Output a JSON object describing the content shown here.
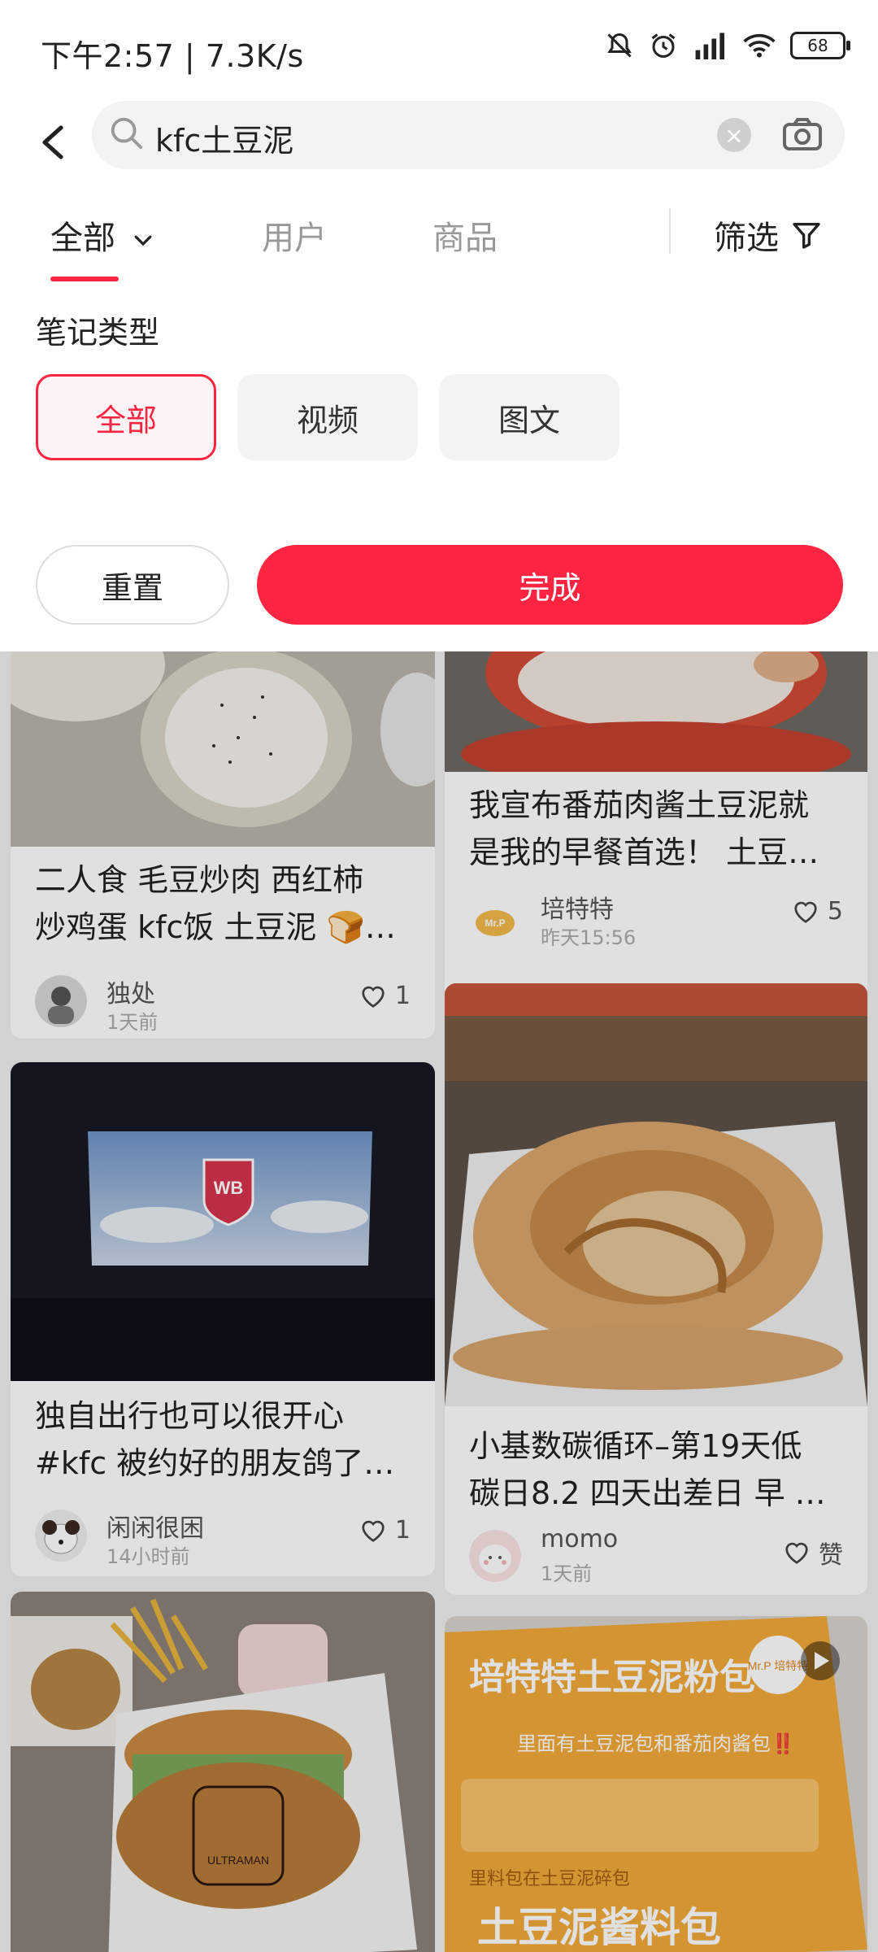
{
  "status": {
    "time": "下午2:57 | 7.3K/s",
    "battery": "68"
  },
  "search": {
    "query": "kfc土豆泥"
  },
  "tabs": {
    "all": "全部",
    "users": "用户",
    "products": "商品",
    "filter": "筛选"
  },
  "panel": {
    "title": "笔记类型",
    "chips": [
      "全部",
      "视频",
      "图文"
    ],
    "reset": "重置",
    "done": "完成"
  },
  "colors": {
    "accent": "#ff2442"
  },
  "feed": {
    "left": [
      {
        "title1": "二人食 毛豆炒肉 西红柿",
        "title2": "炒鸡蛋 kfc饭 土豆泥 🍞…",
        "author": "独处",
        "time": "1天前",
        "likes": "1"
      },
      {
        "title1": "独自出行也可以很开心",
        "title2": "#kfc  被约好的朋友鸽了…",
        "author": "闲闲很困",
        "time": "14小时前",
        "likes": "1"
      }
    ],
    "right": [
      {
        "title1": "我宣布番茄肉酱土豆泥就",
        "title2": "是我的早餐首选！ 土豆…",
        "author": "培特特",
        "time": "昨天15:56",
        "likes": "5"
      },
      {
        "title1": "小基数碳循环–第19天低",
        "title2": "碳日8.2 四天出差日 早 …",
        "author": "momo",
        "time": "1天前",
        "likes": "赞"
      }
    ],
    "img_text": {
      "wb": "WB",
      "pack_brand": "培特特土豆泥粉包",
      "pack_caption": "里面有土豆泥包和番茄肉酱包‼️",
      "pack_sub": "里料包在土豆泥碎包",
      "pack_logo": "Mr.P 培特特",
      "avatar_logo": "Mr.P",
      "burger_print": "ULTRAMAN"
    }
  }
}
